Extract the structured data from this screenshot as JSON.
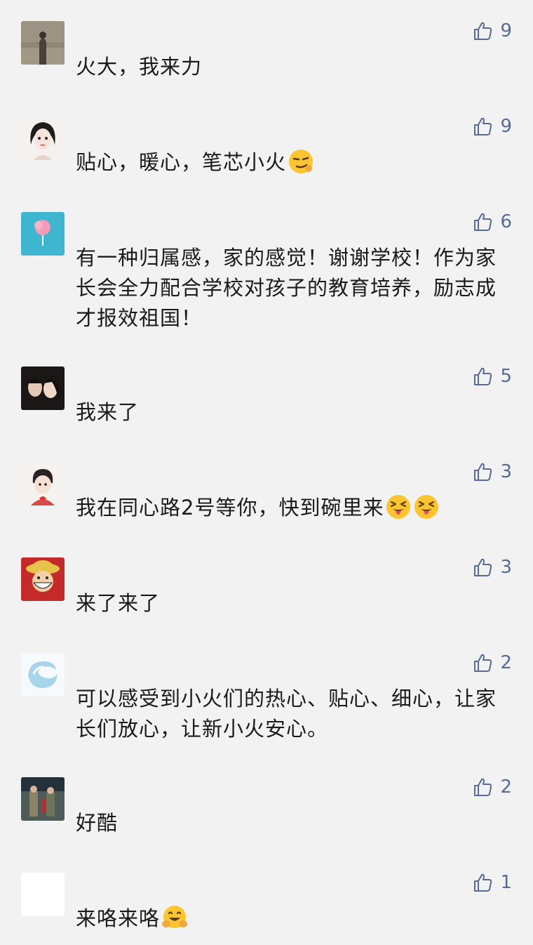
{
  "comments": [
    {
      "text": "火大，我来力",
      "likes": "9",
      "emojis": [],
      "avatar": "desert-photo"
    },
    {
      "text": "贴心，暖心，笔芯小火",
      "likes": "9",
      "emojis": [
        "smirk-emoji"
      ],
      "avatar": "anime-girl"
    },
    {
      "text": "有一种归属感，家的感觉！谢谢学校！作为家长会全力配合学校对孩子的教育培养，励志成才报效祖国！",
      "likes": "6",
      "emojis": [],
      "avatar": "cotton-candy"
    },
    {
      "text": "我来了",
      "likes": "5",
      "emojis": [],
      "avatar": "couple-photo"
    },
    {
      "text": "我在同心路2号等你，快到碗里来",
      "likes": "3",
      "emojis": [
        "tongue-emoji",
        "tongue-emoji"
      ],
      "avatar": "cartoon-boy-heart"
    },
    {
      "text": "来了来了",
      "likes": "3",
      "emojis": [],
      "avatar": "luffy-cartoon"
    },
    {
      "text": "可以感受到小火们的热心、贴心、细心，让家长们放心，让新小火安心。",
      "likes": "2",
      "emojis": [],
      "avatar": "swirl-logo"
    },
    {
      "text": "好酷",
      "likes": "2",
      "emojis": [],
      "avatar": "soldiers-photo"
    },
    {
      "text": "来咯来咯",
      "likes": "1",
      "emojis": [
        "hug-emoji"
      ],
      "avatar": "blank"
    }
  ],
  "colors": {
    "like": "#576b95",
    "text": "#1a1a1a",
    "background": "#f2f2f2"
  }
}
